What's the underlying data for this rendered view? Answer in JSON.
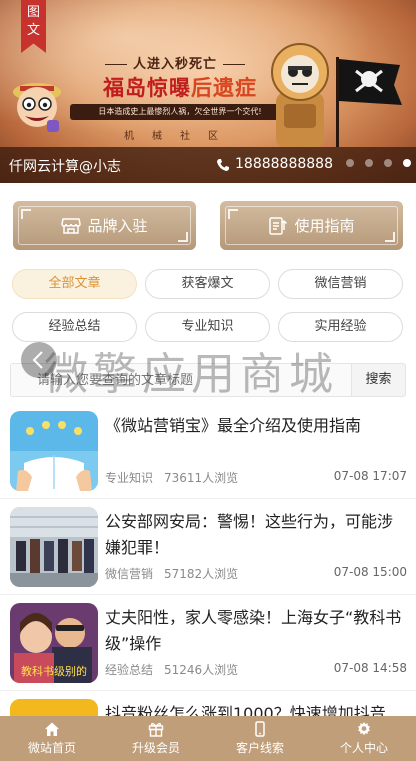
{
  "banner": {
    "tag": "图文",
    "headline_small": "人进入秒死亡",
    "headline_big_a": "福岛惊曝",
    "headline_big_b": "后遗症",
    "headline_bar": "日本造成史上最惨烈人祸，欠全世界一个交代!",
    "headline_sub": "机械社区",
    "info_name": "仟网云计算@小志",
    "info_phone": "18888888888",
    "slide_count": 4,
    "active_slide": 3
  },
  "buttons": {
    "brand_join": "品牌入驻",
    "user_guide": "使用指南"
  },
  "tabs": [
    {
      "label": "全部文章",
      "active": true
    },
    {
      "label": "获客爆文",
      "active": false
    },
    {
      "label": "微信营销",
      "active": false
    },
    {
      "label": "经验总结",
      "active": false
    },
    {
      "label": "专业知识",
      "active": false
    },
    {
      "label": "实用经验",
      "active": false
    }
  ],
  "search": {
    "placeholder": "请输入您要查询的文章标题",
    "button": "搜索"
  },
  "watermark": "微擎应用商城",
  "articles": [
    {
      "title": "《微站营销宝》最全介绍及使用指南",
      "category": "专业知识",
      "views": "73611人浏览",
      "date": "07-08 17:07"
    },
    {
      "title": "公安部网安局：警惕！这些行为，可能涉嫌犯罪！",
      "category": "微信营销",
      "views": "57182人浏览",
      "date": "07-08 15:00"
    },
    {
      "title": "丈夫阳性，家人零感染！上海女子“教科书级”操作",
      "category": "经验总结",
      "views": "51246人浏览",
      "date": "07-08 14:58",
      "thumb_caption": "教科书级别的"
    },
    {
      "title": "抖音粉丝怎么涨到1000？快速增加抖音",
      "category": "",
      "views": "",
      "date": ""
    }
  ],
  "bottom_nav": [
    {
      "label": "微站首页",
      "icon": "home-icon"
    },
    {
      "label": "升级会员",
      "icon": "gift-icon"
    },
    {
      "label": "客户线索",
      "icon": "phone-icon"
    },
    {
      "label": "个人中心",
      "icon": "gear-icon"
    }
  ],
  "colors": {
    "accent": "#c09e79",
    "tab_active_text": "#d89236",
    "tab_active_bg": "#fbf1df",
    "ribbon": "#c7322f"
  }
}
